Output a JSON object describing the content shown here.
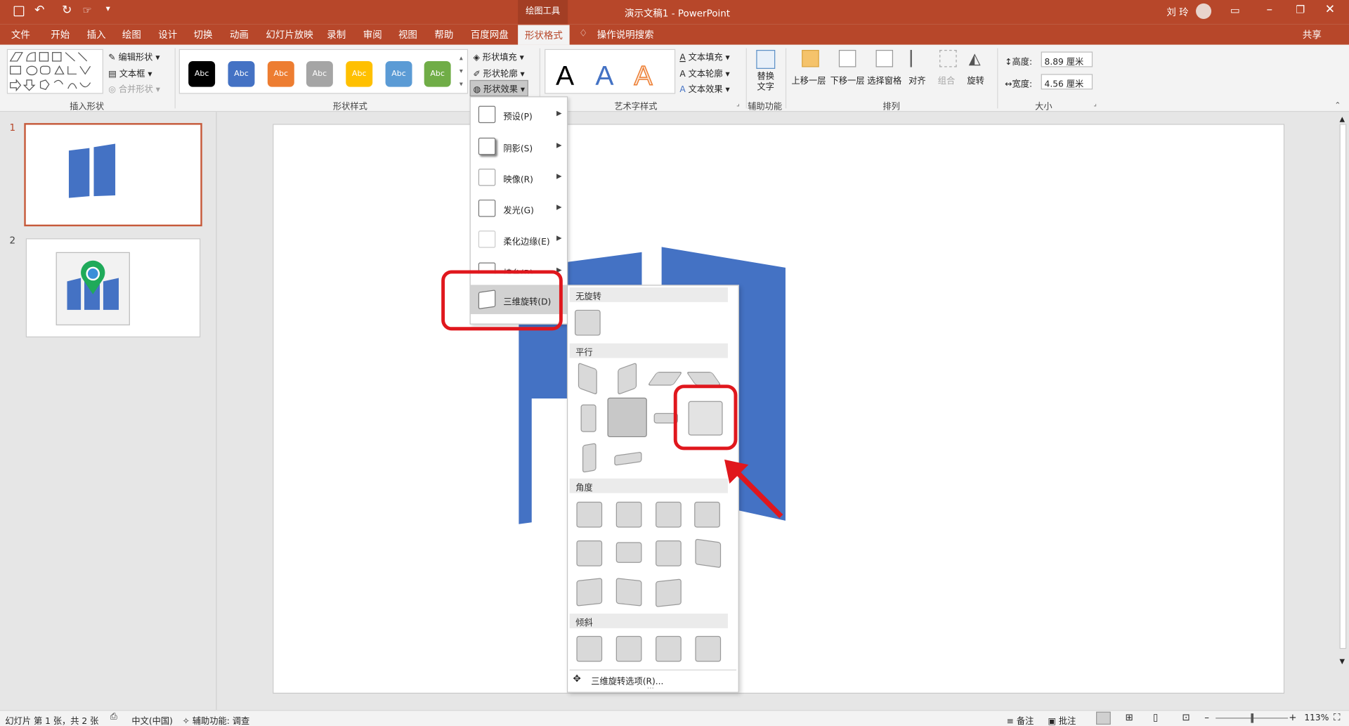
{
  "app": {
    "context_tab": "绘图工具",
    "title": "演示文稿1 - PowerPoint",
    "user": "刘 玲",
    "share": "共享",
    "search": "操作说明搜索"
  },
  "tabs": [
    "文件",
    "开始",
    "插入",
    "绘图",
    "设计",
    "切换",
    "动画",
    "幻灯片放映",
    "录制",
    "审阅",
    "视图",
    "帮助",
    "百度网盘",
    "形状格式"
  ],
  "ribbon": {
    "insert_shapes": {
      "edit_shape": "编辑形状",
      "textbox": "文本框",
      "merge": "合并形状",
      "label": "插入形状"
    },
    "shape_styles": {
      "swatch_text": "Abc",
      "fill": "形状填充",
      "outline": "形状轮廓",
      "effects": "形状效果",
      "label": "形状样式",
      "colors": [
        "#000000",
        "#4472c4",
        "#ed7d31",
        "#a5a5a5",
        "#ffc000",
        "#5b9bd5",
        "#70ad47"
      ]
    },
    "wordart": {
      "letter": "A",
      "text_fill": "文本填充",
      "text_outline": "文本轮廓",
      "text_effects": "文本效果",
      "label": "艺术字样式"
    },
    "accessibility": {
      "alt_text": "替换文字",
      "label": "辅助功能"
    },
    "arrange": {
      "bring_forward": "上移一层",
      "send_backward": "下移一层",
      "selection_pane": "选择窗格",
      "align": "对齐",
      "group": "组合",
      "rotate": "旋转",
      "label": "排列"
    },
    "size": {
      "height_label": "高度:",
      "height": "8.89 厘米",
      "width_label": "宽度:",
      "width": "4.56 厘米",
      "label": "大小"
    }
  },
  "thumbnails": [
    {
      "num": "1"
    },
    {
      "num": "2"
    }
  ],
  "effects_menu": [
    {
      "label": "预设(P)"
    },
    {
      "label": "阴影(S)"
    },
    {
      "label": "映像(R)"
    },
    {
      "label": "发光(G)"
    },
    {
      "label": "柔化边缘(E)"
    },
    {
      "label": "棱台(B)"
    },
    {
      "label": "三维旋转(D)"
    }
  ],
  "rotation_submenu": {
    "sections": {
      "none": "无旋转",
      "parallel": "平行",
      "perspective": "角度",
      "oblique": "倾斜"
    },
    "options_link": "三维旋转选项(R)..."
  },
  "status": {
    "slide_info": "幻灯片 第 1 张，共 2 张",
    "language": "中文(中国)",
    "accessibility": "辅助功能: 调查",
    "notes": "备注",
    "comments": "批注",
    "zoom": "113%"
  },
  "colors": {
    "accent": "#b7472a",
    "shape_blue": "#4472c4",
    "highlight_red": "#e0171d"
  }
}
